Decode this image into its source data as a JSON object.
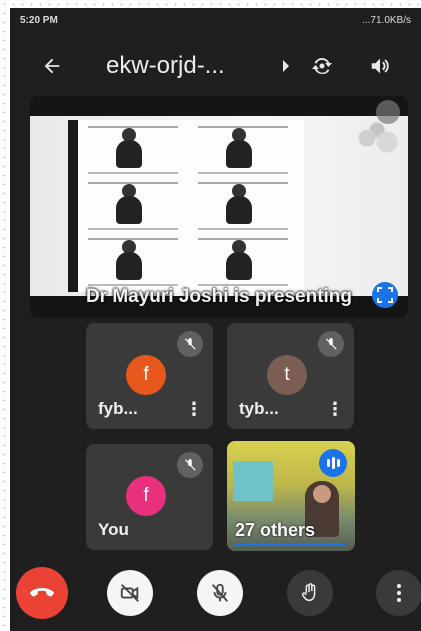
{
  "status_bar": {
    "time": "5:20 PM",
    "right": "...71.0KB/s"
  },
  "header": {
    "meeting_code": "ekw-orjd-...",
    "icons": [
      "back-arrow-icon",
      "chevron-right-icon",
      "switch-camera-icon",
      "speaker-icon"
    ]
  },
  "presentation": {
    "caption": "Dr Mayuri Joshi is presenting",
    "icons": [
      "pin-icon",
      "fullscreen-icon"
    ]
  },
  "participants": [
    {
      "name": "fyb...",
      "initial": "f",
      "avatar_color": "#e8581c",
      "muted": true
    },
    {
      "name": "tyb...",
      "initial": "t",
      "avatar_color": "#7b5d53",
      "muted": true
    },
    {
      "name": "You",
      "initial": "f",
      "avatar_color": "#e8317c",
      "muted": true
    }
  ],
  "others_tile": {
    "label": "27 others",
    "speaking": true
  },
  "controls": [
    "end-call",
    "camera-off",
    "mic-off",
    "raise-hand",
    "more-options"
  ],
  "colors": {
    "background": "#1f1f1f",
    "tile": "#3a3a3a",
    "accent": "#1a73e8",
    "end_call": "#ea4335"
  }
}
